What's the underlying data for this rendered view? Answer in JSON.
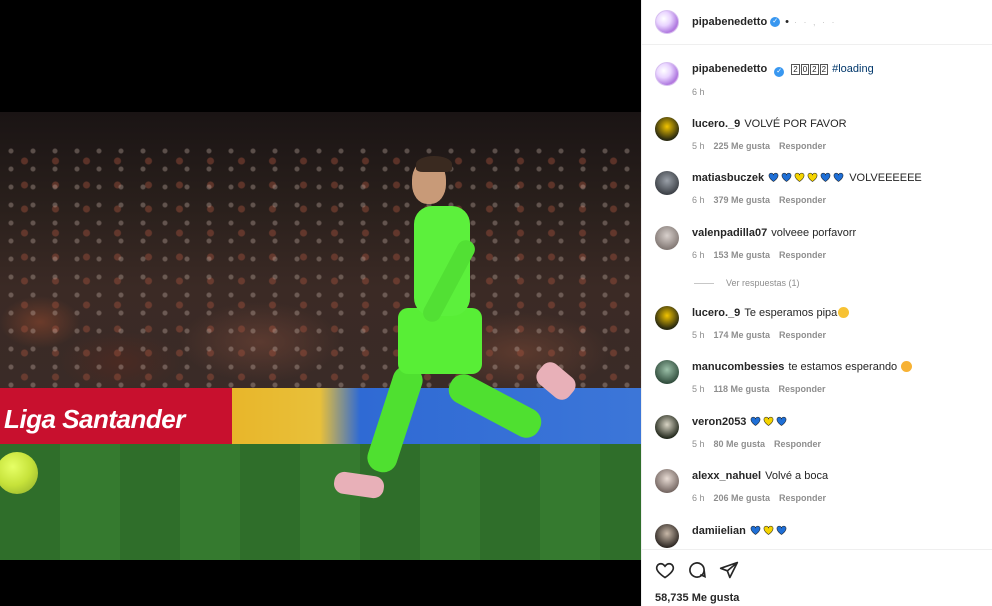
{
  "header": {
    "username": "pipabenedetto",
    "separator": "•",
    "faint_text": "· · , · ·"
  },
  "caption": {
    "username": "pipabenedetto",
    "boxed_digits": [
      "2",
      "0",
      "2",
      "2"
    ],
    "hashtag": "#loading",
    "time": "6 h"
  },
  "comments": [
    {
      "username": "lucero._9",
      "text": "VOLVÉ POR FAVOR",
      "time": "5 h",
      "likes": "225 Me gusta",
      "reply": "Responder"
    },
    {
      "username": "matiasbuczek",
      "hearts": [
        "blue",
        "blue",
        "yellow",
        "yellow",
        "blue",
        "blue"
      ],
      "text": "VOLVEEEEEE",
      "time": "6 h",
      "likes": "379 Me gusta",
      "reply": "Responder"
    },
    {
      "username": "valenpadilla07",
      "text": "volveee porfavorr",
      "time": "6 h",
      "likes": "153 Me gusta",
      "reply": "Responder",
      "view_replies": "Ver respuestas (1)"
    },
    {
      "username": "lucero._9",
      "text": "Te esperamos pipa",
      "time": "5 h",
      "likes": "174 Me gusta",
      "reply": "Responder"
    },
    {
      "username": "manucombessies",
      "text": "te estamos esperando",
      "time": "5 h",
      "likes": "118 Me gusta",
      "reply": "Responder"
    },
    {
      "username": "veron2053",
      "hearts": [
        "blue",
        "yellow",
        "blue"
      ],
      "text": "",
      "time": "5 h",
      "likes": "80 Me gusta",
      "reply": "Responder"
    },
    {
      "username": "alexx_nahuel",
      "text": "Volvé a boca",
      "time": "6 h",
      "likes": "206 Me gusta",
      "reply": "Responder"
    },
    {
      "username": "damiielian",
      "hearts": [
        "blue",
        "yellow",
        "blue"
      ],
      "text": ""
    }
  ],
  "photo": {
    "ad_text": "Liga Santander"
  },
  "footer": {
    "likes": "58,735 Me gusta"
  },
  "colors": {
    "heart_blue": "#1f6fd6",
    "heart_yellow": "#f5d400",
    "link": "#00376b",
    "verified": "#3897f0"
  },
  "icons": [
    "heart-icon",
    "comment-icon",
    "share-icon",
    "verified-icon"
  ]
}
